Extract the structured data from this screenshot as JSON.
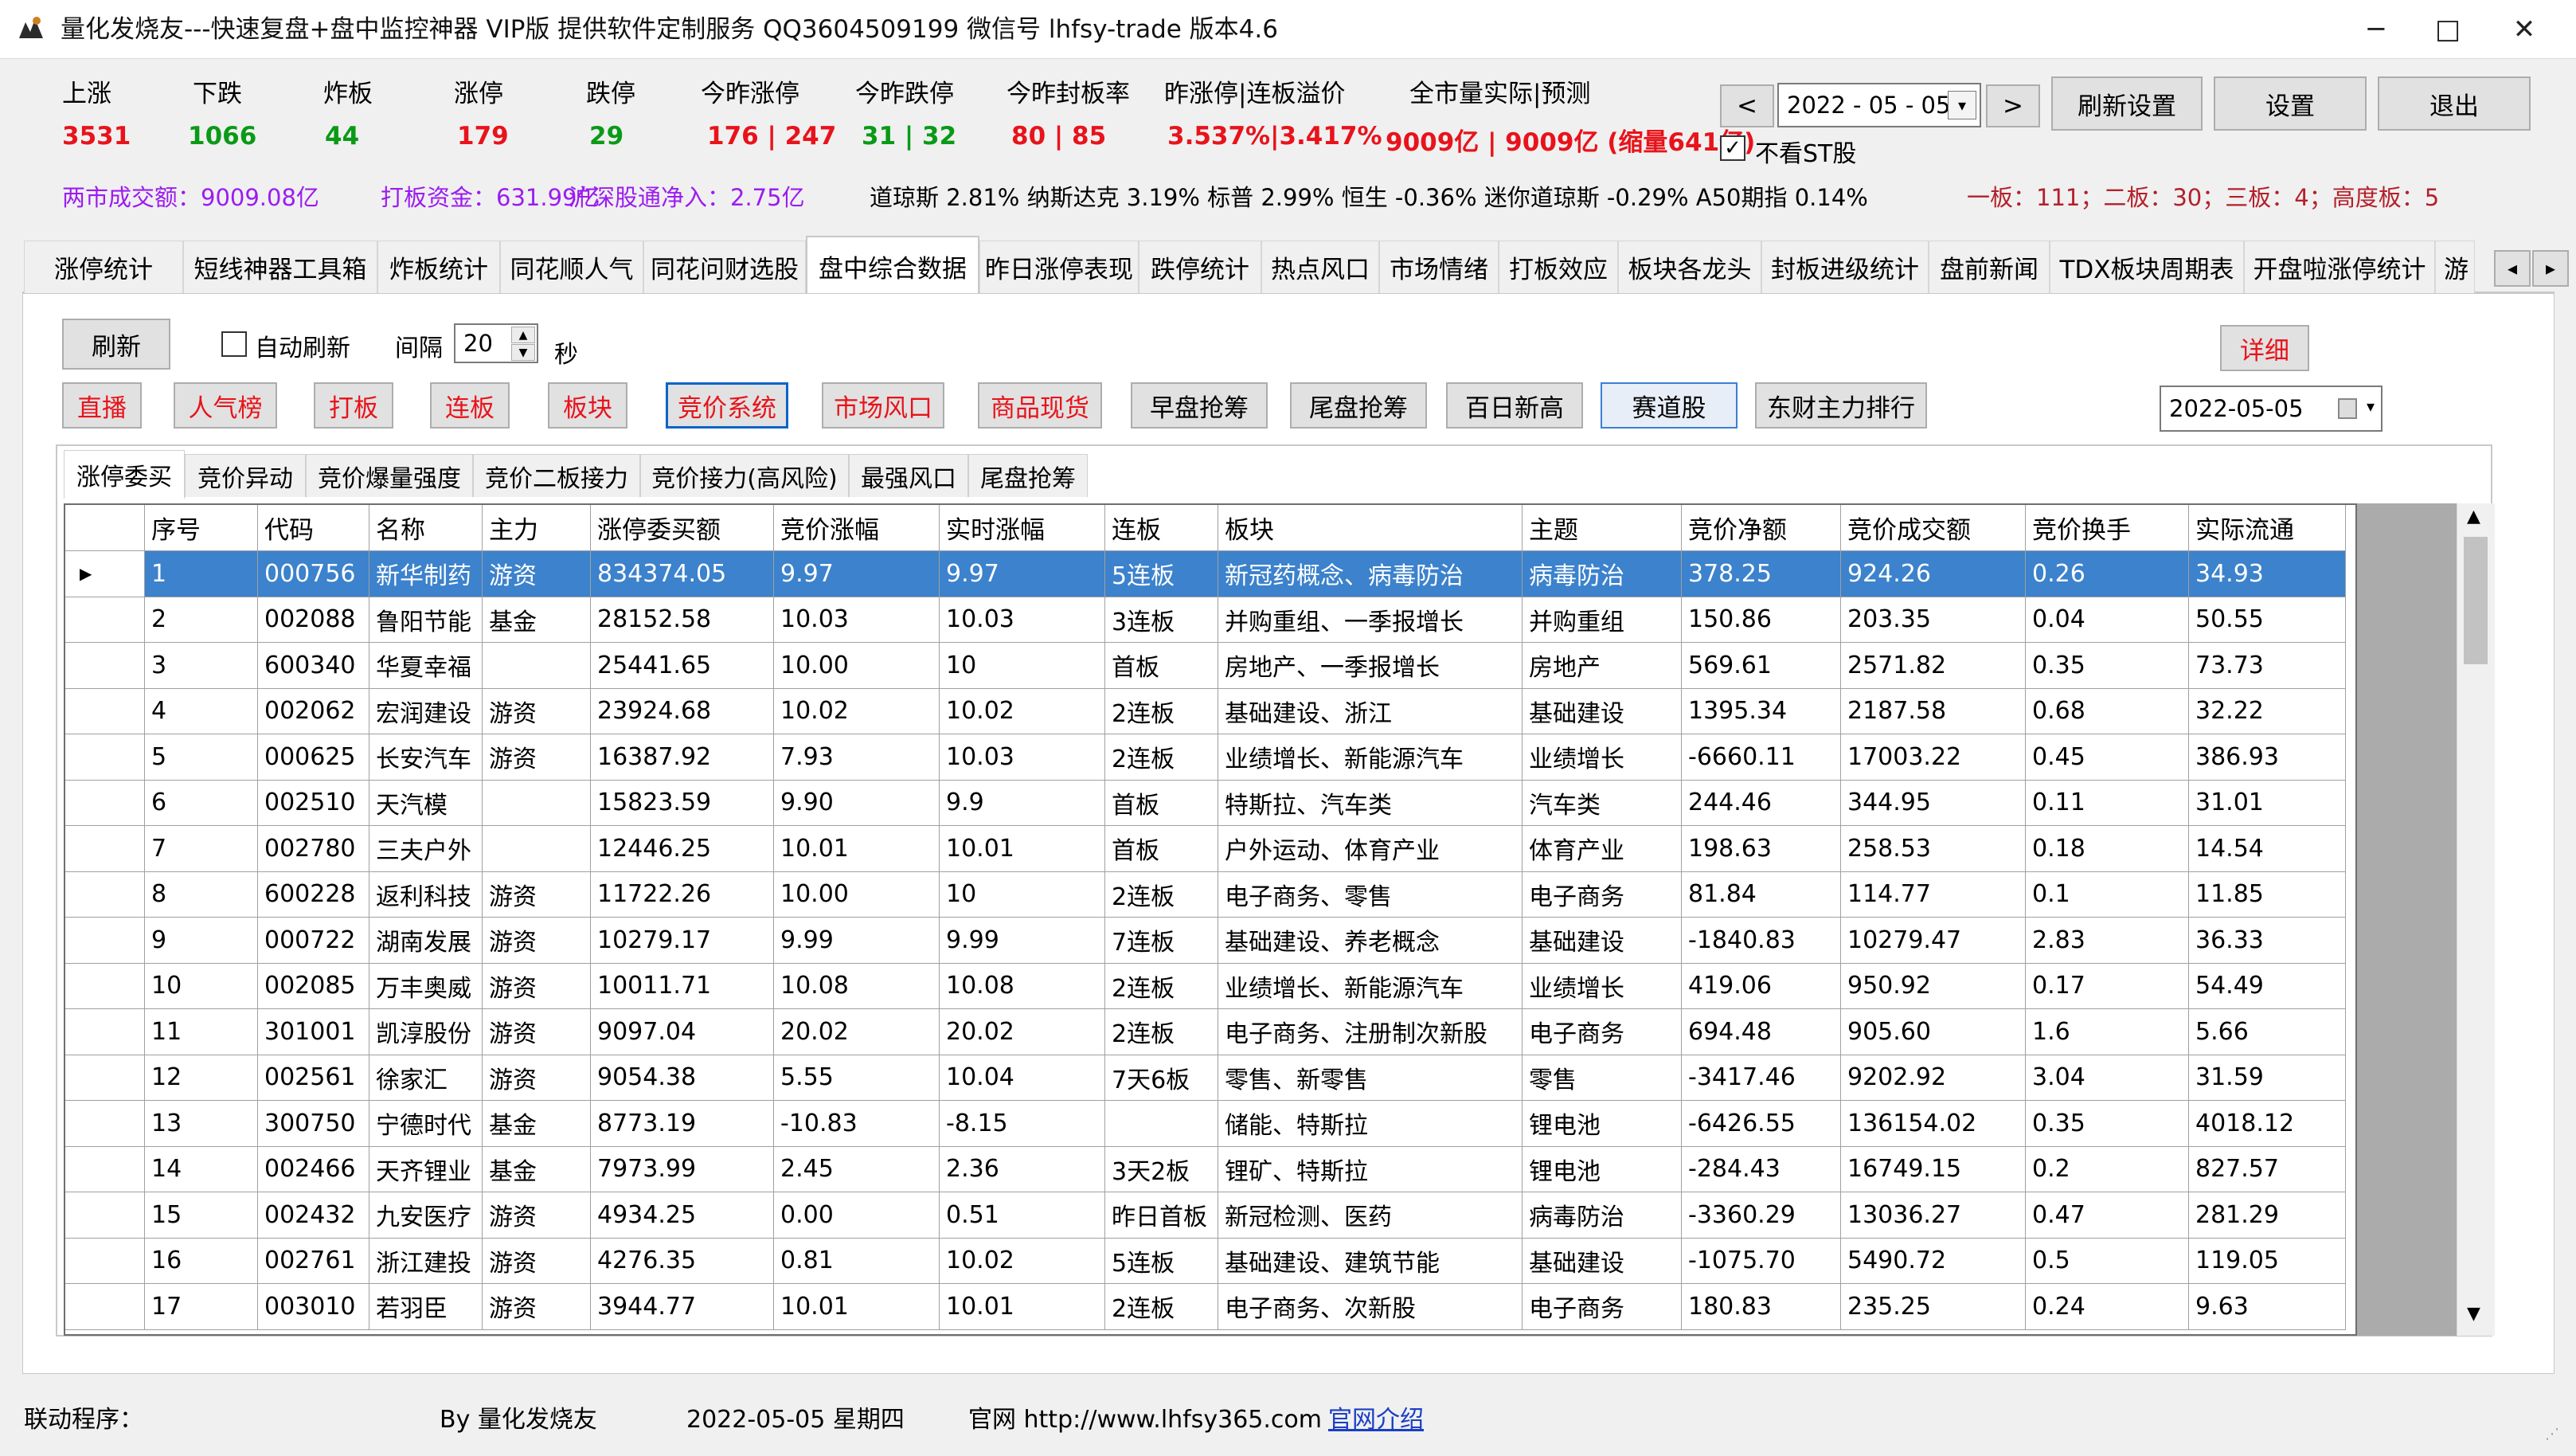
{
  "window": {
    "title": "量化发烧友---快速复盘+盘中监控神器 VIP版  提供软件定制服务 QQ3604509199 微信号 lhfsy-trade  版本4.6",
    "minimize": "─",
    "maximize": "□",
    "close": "✕"
  },
  "stats": [
    {
      "label": "上涨",
      "value": "3531",
      "color": "red"
    },
    {
      "label": "下跌",
      "value": "1066",
      "color": "green"
    },
    {
      "label": "炸板",
      "value": "44",
      "color": "green"
    },
    {
      "label": "涨停",
      "value": "179",
      "color": "red"
    },
    {
      "label": "跌停",
      "value": "29",
      "color": "green"
    },
    {
      "label": "今昨涨停",
      "value": "176 | 247",
      "color": "red"
    },
    {
      "label": "今昨跌停",
      "value": "31 | 32",
      "color": "green"
    },
    {
      "label": "今昨封板率",
      "value": "80 | 85",
      "color": "red"
    },
    {
      "label": "昨涨停|连板溢价",
      "value": "3.537%|3.417%",
      "color": "red"
    },
    {
      "label": "全市量实际|预测",
      "value": "9009亿 | 9009亿 (缩量641亿)",
      "color": "red"
    }
  ],
  "date_nav": {
    "prev": "<",
    "date": "2022 - 05 - 05",
    "next": ">"
  },
  "top_buttons": {
    "refresh_settings": "刷新设置",
    "settings": "设置",
    "exit": "退出"
  },
  "no_st": {
    "checked": true,
    "label": "不看ST股"
  },
  "info_line": {
    "turnover": "两市成交额：9009.08亿",
    "limit_funds": "打板资金：631.99亿",
    "northbound": "沪深股通净入：2.75亿",
    "indices": "道琼斯 2.81%  纳斯达克 3.19%  标普 2.99%  恒生 -0.36%  迷你道琼斯 -0.29%  A50期指 0.14%",
    "boards": "一板：111；二板：30；三板：4；高度板：5"
  },
  "tabs": [
    "涨停统计",
    "短线神器工具箱",
    "炸板统计",
    "同花顺人气",
    "同花问财选股",
    "盘中综合数据",
    "昨日涨停表现",
    "跌停统计",
    "热点风口",
    "市场情绪",
    "打板效应",
    "板块各龙头",
    "封板进级统计",
    "盘前新闻",
    "TDX板块周期表",
    "开盘啦涨停统计",
    "游"
  ],
  "tab_scroll": {
    "left": "◂",
    "right": "▸"
  },
  "controls": {
    "refresh": "刷新",
    "auto_refresh": "自动刷新",
    "interval_label": "间隔",
    "interval_value": "20",
    "seconds": "秒",
    "detail": "详细",
    "date2": "2022-05-05"
  },
  "action_buttons": [
    "直播",
    "人气榜",
    "打板",
    "连板",
    "板块",
    "竞价系统",
    "市场风口",
    "商品现货",
    "早盘抢筹",
    "尾盘抢筹",
    "百日新高",
    "赛道股",
    "东财主力排行"
  ],
  "subtabs": [
    "涨停委买",
    "竞价异动",
    "竞价爆量强度",
    "竞价二板接力",
    "竞价接力(高风险)",
    "最强风口",
    "尾盘抢筹"
  ],
  "columns": [
    "序号",
    "代码",
    "名称",
    "主力",
    "涨停委买额",
    "竞价涨幅",
    "实时涨幅",
    "连板",
    "板块",
    "主题",
    "竞价净额",
    "竞价成交额",
    "竞价换手",
    "实际流通"
  ],
  "rows": [
    [
      "1",
      "000756",
      "新华制药",
      "游资",
      "834374.05",
      "9.97",
      "9.97",
      "5连板",
      "新冠药概念、病毒防治",
      "病毒防治",
      "378.25",
      "924.26",
      "0.26",
      "34.93"
    ],
    [
      "2",
      "002088",
      "鲁阳节能",
      "基金",
      "28152.58",
      "10.03",
      "10.03",
      "3连板",
      "并购重组、一季报增长",
      "并购重组",
      "150.86",
      "203.35",
      "0.04",
      "50.55"
    ],
    [
      "3",
      "600340",
      "华夏幸福",
      "",
      "25441.65",
      "10.00",
      "10",
      "首板",
      "房地产、一季报增长",
      "房地产",
      "569.61",
      "2571.82",
      "0.35",
      "73.73"
    ],
    [
      "4",
      "002062",
      "宏润建设",
      "游资",
      "23924.68",
      "10.02",
      "10.02",
      "2连板",
      "基础建设、浙江",
      "基础建设",
      "1395.34",
      "2187.58",
      "0.68",
      "32.22"
    ],
    [
      "5",
      "000625",
      "长安汽车",
      "游资",
      "16387.92",
      "7.93",
      "10.03",
      "2连板",
      "业绩增长、新能源汽车",
      "业绩增长",
      "-6660.11",
      "17003.22",
      "0.45",
      "386.93"
    ],
    [
      "6",
      "002510",
      "天汽模",
      "",
      "15823.59",
      "9.90",
      "9.9",
      "首板",
      "特斯拉、汽车类",
      "汽车类",
      "244.46",
      "344.95",
      "0.11",
      "31.01"
    ],
    [
      "7",
      "002780",
      "三夫户外",
      "",
      "12446.25",
      "10.01",
      "10.01",
      "首板",
      "户外运动、体育产业",
      "体育产业",
      "198.63",
      "258.53",
      "0.18",
      "14.54"
    ],
    [
      "8",
      "600228",
      "返利科技",
      "游资",
      "11722.26",
      "10.00",
      "10",
      "2连板",
      "电子商务、零售",
      "电子商务",
      "81.84",
      "114.77",
      "0.1",
      "11.85"
    ],
    [
      "9",
      "000722",
      "湖南发展",
      "游资",
      "10279.17",
      "9.99",
      "9.99",
      "7连板",
      "基础建设、养老概念",
      "基础建设",
      "-1840.83",
      "10279.47",
      "2.83",
      "36.33"
    ],
    [
      "10",
      "002085",
      "万丰奥威",
      "游资",
      "10011.71",
      "10.08",
      "10.08",
      "2连板",
      "业绩增长、新能源汽车",
      "业绩增长",
      "419.06",
      "950.92",
      "0.17",
      "54.49"
    ],
    [
      "11",
      "301001",
      "凯淳股份",
      "游资",
      "9097.04",
      "20.02",
      "20.02",
      "2连板",
      "电子商务、注册制次新股",
      "电子商务",
      "694.48",
      "905.60",
      "1.6",
      "5.66"
    ],
    [
      "12",
      "002561",
      "徐家汇",
      "游资",
      "9054.38",
      "5.55",
      "10.04",
      "7天6板",
      "零售、新零售",
      "零售",
      "-3417.46",
      "9202.92",
      "3.04",
      "31.59"
    ],
    [
      "13",
      "300750",
      "宁德时代",
      "基金",
      "8773.19",
      "-10.83",
      "-8.15",
      "",
      "储能、特斯拉",
      "锂电池",
      "-6426.55",
      "136154.02",
      "0.35",
      "4018.12"
    ],
    [
      "14",
      "002466",
      "天齐锂业",
      "基金",
      "7973.99",
      "2.45",
      "2.36",
      "3天2板",
      "锂矿、特斯拉",
      "锂电池",
      "-284.43",
      "16749.15",
      "0.2",
      "827.57"
    ],
    [
      "15",
      "002432",
      "九安医疗",
      "游资",
      "4934.25",
      "0.00",
      "0.51",
      "昨日首板",
      "新冠检测、医药",
      "病毒防治",
      "-3360.29",
      "13036.27",
      "0.47",
      "281.29"
    ],
    [
      "16",
      "002761",
      "浙江建投",
      "游资",
      "4276.35",
      "0.81",
      "10.02",
      "5连板",
      "基础建设、建筑节能",
      "基础建设",
      "-1075.70",
      "5490.72",
      "0.5",
      "119.05"
    ],
    [
      "17",
      "003010",
      "若羽臣",
      "游资",
      "3944.77",
      "10.01",
      "10.01",
      "2连板",
      "电子商务、次新股",
      "电子商务",
      "180.83",
      "235.25",
      "0.24",
      "9.63"
    ]
  ],
  "row_marker": "▶",
  "scroll": {
    "up": "▲",
    "down": "▼"
  },
  "statusbar": {
    "linked": "联动程序：",
    "by": "By 量化发烧友",
    "date": "2022-05-05 星期四",
    "site": "官网 http://www.lhfsy365.com",
    "intro": "官网介绍"
  },
  "colors": {
    "up": "#e8131b",
    "down": "#0a9a16",
    "selection": "#3c82cc",
    "link": "#1a3fc4",
    "info": "#9b1cf0"
  }
}
